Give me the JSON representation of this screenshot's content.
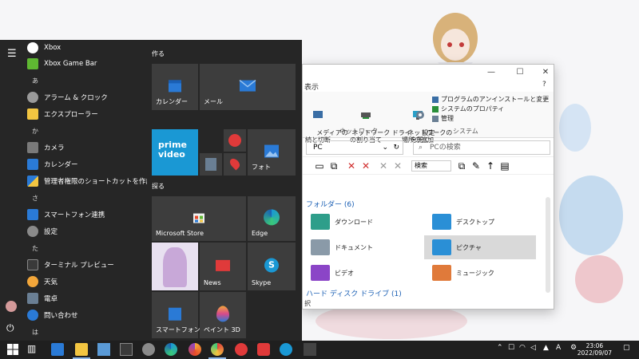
{
  "start_menu": {
    "rail": {
      "menu_icon": "hamburger-icon",
      "user_icon": "avatar",
      "power_icon": "power-icon"
    },
    "apps": [
      {
        "type": "app",
        "label": "Xbox",
        "icon": "xbox-icon"
      },
      {
        "type": "app",
        "label": "Xbox Game Bar",
        "icon": "xbox-game-bar-icon"
      },
      {
        "type": "letter",
        "label": "あ"
      },
      {
        "type": "app",
        "label": "アラーム & クロック",
        "icon": "alarm-clock-icon"
      },
      {
        "type": "app",
        "label": "エクスプローラー",
        "icon": "file-explorer-icon"
      },
      {
        "type": "letter",
        "label": "か"
      },
      {
        "type": "app",
        "label": "カメラ",
        "icon": "camera-icon"
      },
      {
        "type": "app",
        "label": "カレンダー",
        "icon": "calendar-icon"
      },
      {
        "type": "app",
        "label": "管理者権限のショートカットを作成するノ",
        "icon": "shield-icon"
      },
      {
        "type": "letter",
        "label": "さ"
      },
      {
        "type": "app",
        "label": "スマートフォン連携",
        "icon": "phone-link-icon"
      },
      {
        "type": "app",
        "label": "設定",
        "icon": "settings-gear-icon"
      },
      {
        "type": "letter",
        "label": "た"
      },
      {
        "type": "app",
        "label": "ターミナル プレビュー",
        "icon": "terminal-icon"
      },
      {
        "type": "app",
        "label": "天気",
        "icon": "weather-icon"
      },
      {
        "type": "app",
        "label": "電卓",
        "icon": "calculator-icon"
      },
      {
        "type": "app",
        "label": "問い合わせ",
        "icon": "help-icon"
      },
      {
        "type": "letter",
        "label": "は"
      }
    ],
    "group_create": "作る",
    "group_explore": "探る",
    "tiles": {
      "calendar": "カレンダー",
      "mail": "メール",
      "prime": "prime video",
      "photos": "フォト",
      "store": "Microsoft Store",
      "edge": "Edge",
      "news": "News",
      "skype": "Skype",
      "phone": "スマートフォン連携",
      "paint3d": "ペイント 3D"
    }
  },
  "explorer": {
    "ribbon_tab": "表示",
    "ribbon": {
      "media": "メディアの\n続と切断",
      "map_drive": "ネットワーク ドライ\nの割り当て",
      "add_location": "ネットワークの\n場所の追加",
      "network_group": "ネットワーク",
      "open_settings": "設定\nを開く",
      "uninstall": "プログラムのアンインストールと変更",
      "system_props": "システムのプロパティ",
      "manage": "管理",
      "system_group": "システム"
    },
    "address": "PC",
    "search_placeholder": "PCの検索",
    "toolbar_search": "検索",
    "folders_header": "フォルダー (6)",
    "folders": [
      {
        "name": "ダウンロード",
        "color": "#2e9e8a"
      },
      {
        "name": "デスクトップ",
        "color": "#2a8fd6"
      },
      {
        "name": "ドキュメント",
        "color": "#8a9aa8"
      },
      {
        "name": "ピクチャ",
        "color": "#2a8fd6"
      },
      {
        "name": "ビデオ",
        "color": "#8b45c7"
      },
      {
        "name": "ミュージック",
        "color": "#e07a3a"
      }
    ],
    "drives_header": "ハード ディスク ドライブ (1)",
    "status": "択"
  },
  "taskbar": {
    "time": "23:06",
    "date": "2022/09/07"
  },
  "colors": {
    "start_bg": "#262626",
    "tile_bg": "#3d3d3d",
    "accent": "#1a5fb4"
  }
}
